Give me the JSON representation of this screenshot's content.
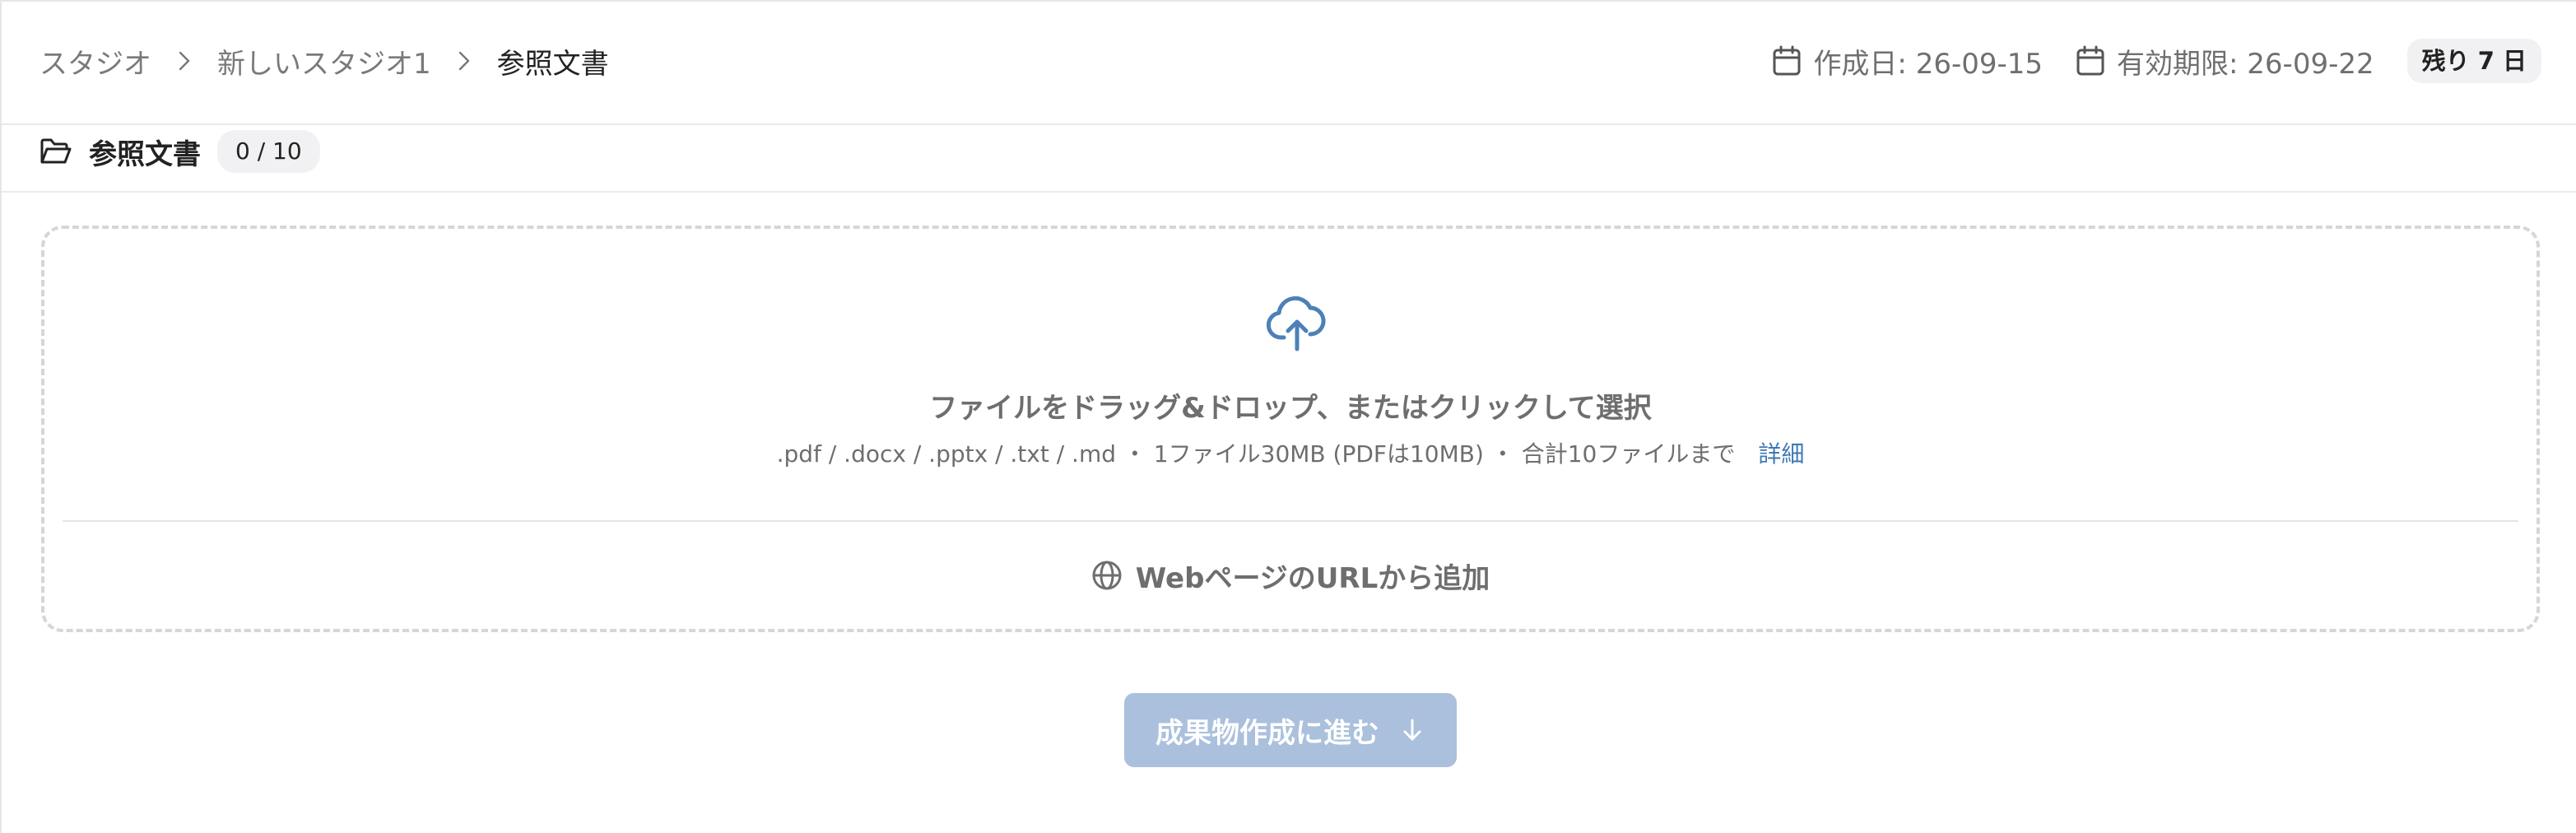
{
  "breadcrumb": {
    "items": [
      "スタジオ",
      "新しいスタジオ1",
      "参照文書"
    ]
  },
  "meta": {
    "created": "作成日: 26-09-15",
    "expires": "有効期限: 26-09-22",
    "remaining": "残り 7 日"
  },
  "section": {
    "title": "参照文書",
    "count": "0 / 10"
  },
  "dropzone": {
    "title": "ファイルをドラッグ&ドロップ、またはクリックして選択",
    "subtitle": ".pdf / .docx / .pptx / .txt / .md ・ 1ファイル30MB (PDFは10MB) ・ 合計10ファイルまで",
    "detail_link": "詳細",
    "url_add": "WebページのURLから追加"
  },
  "next_button": {
    "label": "成果物作成に進む",
    "state": "disabled"
  },
  "icons": {
    "breadcrumb_separator": "chevron-right-icon",
    "date": "calendar-icon",
    "section": "folder-open-icon",
    "upload": "cloud-upload-icon",
    "url": "globe-icon",
    "next": "arrow-down-icon"
  },
  "colors": {
    "accent": "#3f78b4",
    "button_disabled_bg": "#aac0dc",
    "badge_bg": "#f1f1f3",
    "dashed_border": "#d6d6d9"
  }
}
